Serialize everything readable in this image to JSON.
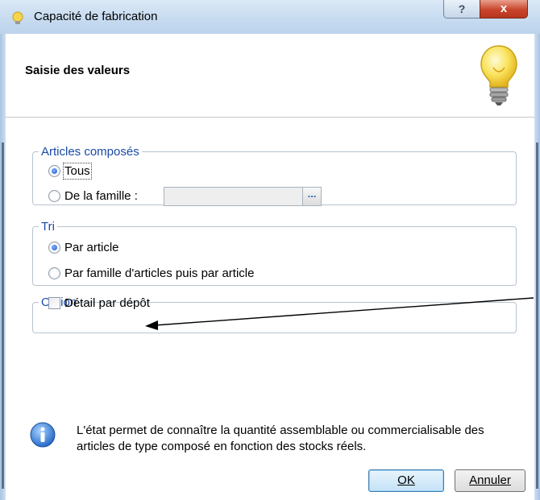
{
  "window": {
    "title": "Capacité de fabrication",
    "help_label": "?",
    "close_label": "x"
  },
  "header": {
    "title": "Saisie des valeurs"
  },
  "articles_group": {
    "legend": "Articles composés",
    "option_all": "Tous",
    "option_family": "De la famille :",
    "family_value": "",
    "browse_label": "..."
  },
  "sort_group": {
    "legend": "Tri",
    "option_article": "Par article",
    "option_family_article": "Par famille d'articles puis par article"
  },
  "option_group": {
    "legend": "Option",
    "detail_label": "Détail par dépôt"
  },
  "info": {
    "text": "L'état permet de connaître la quantité assemblable ou commercialisable des articles de type composé en fonction des stocks réels."
  },
  "buttons": {
    "ok": "OK",
    "cancel": "Annuler"
  },
  "colors": {
    "legend": "#1a4aa8",
    "title_bar": "#c7dbf0",
    "close_button": "#c8452c"
  }
}
